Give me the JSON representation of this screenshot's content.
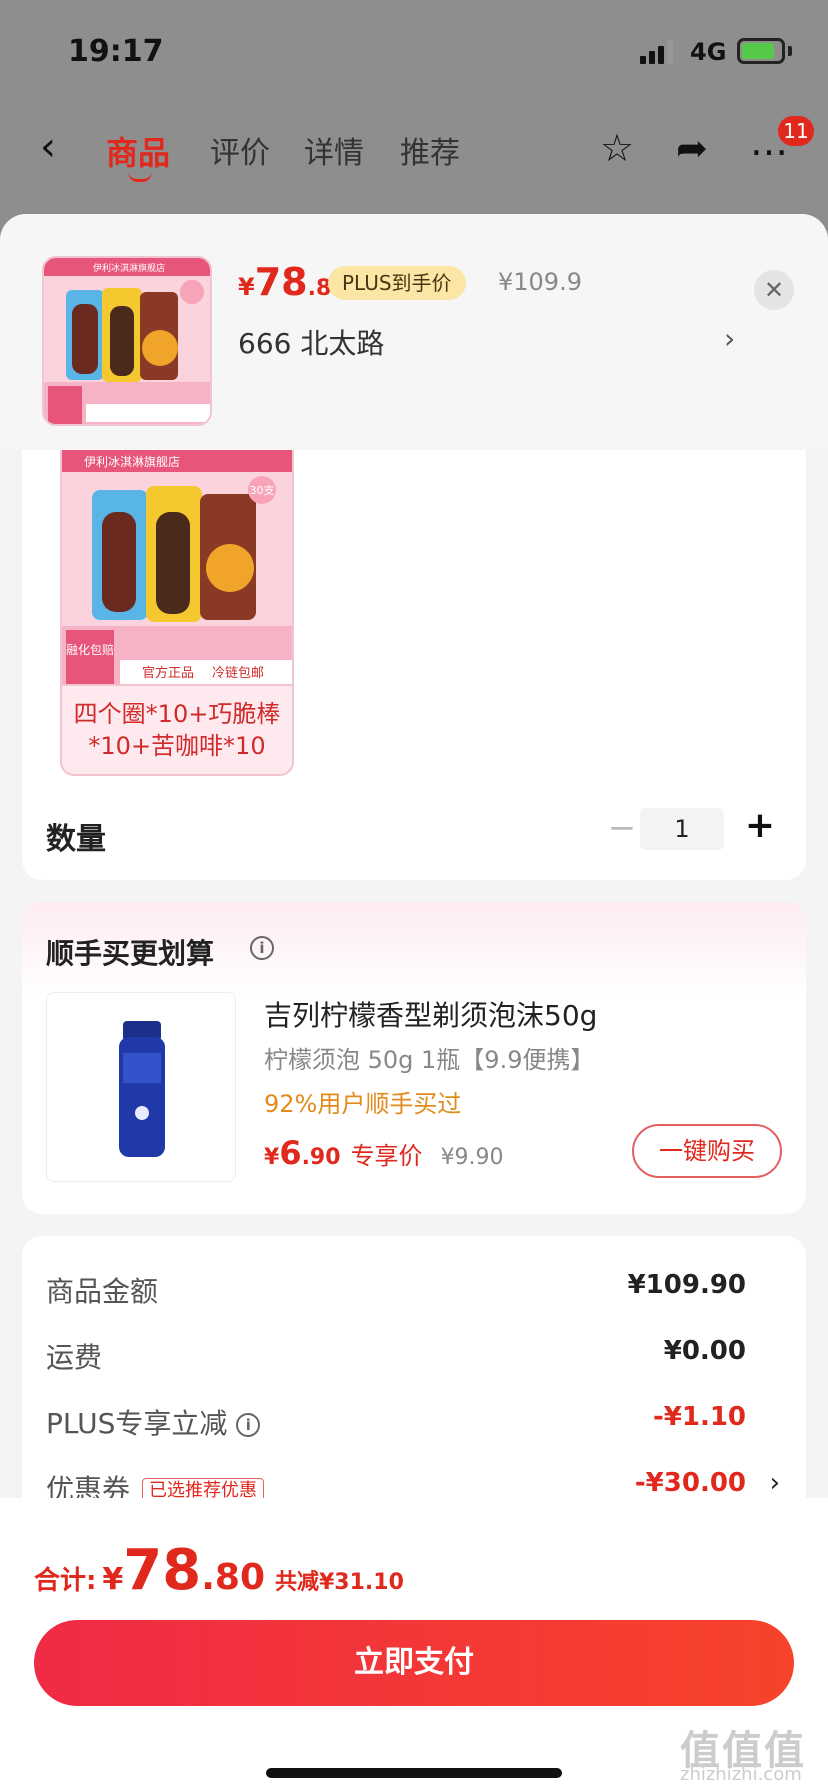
{
  "status_bar": {
    "time": "19:17",
    "network": "4G"
  },
  "nav": {
    "tabs": [
      "商品",
      "评价",
      "详情",
      "推荐"
    ],
    "badge": "11"
  },
  "header": {
    "price_symbol": "¥",
    "price_int": "78",
    "price_dec": ".8",
    "plus_tag": "PLUS到手价",
    "original_price": "¥109.9",
    "address": "666  北太路",
    "thumb_text": "伊利冰淇淋旗舰店"
  },
  "product": {
    "brand": "伊利冰淇淋旗舰店",
    "count_badge": "30支",
    "footer_a": "融化包赔",
    "footer_b": "官方正品",
    "footer_c": "冷链包邮",
    "variant_line1": "四个圈*10+巧脆棒",
    "variant_line2": "*10+苦咖啡*10",
    "quantity_label": "数量",
    "quantity": "1"
  },
  "upsell": {
    "title": "顺手买更划算",
    "name": "吉列柠檬香型剃须泡沫50g",
    "spec": "柠檬须泡 50g 1瓶【9.9便携】",
    "buyers": "92%用户顺手买过",
    "price_symbol": "¥",
    "price_int": "6",
    "price_dec": ".90",
    "price_tag": "专享价",
    "original_price": "¥9.90",
    "buy_label": "一键购买"
  },
  "summary": {
    "rows": [
      {
        "label": "商品金额",
        "value": "¥109.90"
      },
      {
        "label": "运费",
        "value": "¥0.00"
      },
      {
        "label": "PLUS专享立减",
        "value": "-¥1.10"
      },
      {
        "label": "优惠券",
        "value": "-¥30.00",
        "tag": "已选推荐优惠"
      }
    ]
  },
  "bottom": {
    "total_label": "合计:",
    "total_symbol": "¥",
    "total_int": "78",
    "total_dec": ".80",
    "total_save": "共减¥31.10",
    "pay_label": "立即支付",
    "watermark": "值值值",
    "watermark_sub": "zhizhizhi.com"
  },
  "colors": {
    "accent": "#e0281d",
    "plus_tag": "#fbe6a6",
    "buyers": "#e28a1b"
  }
}
